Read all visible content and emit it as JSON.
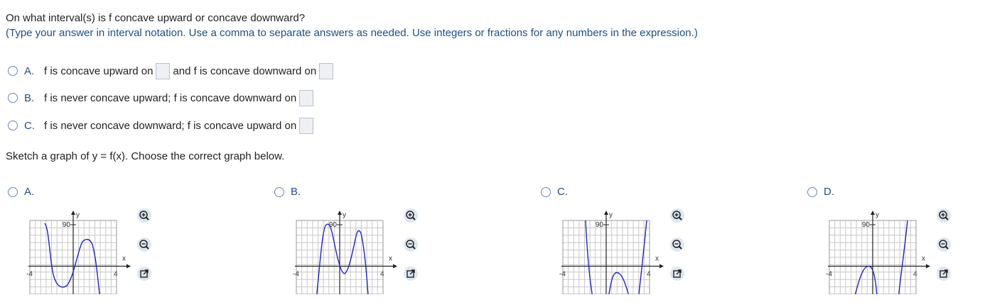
{
  "question1": {
    "prompt": "On what interval(s) is f concave upward or concave downward?",
    "instructions": "(Type your answer in interval notation. Use a comma to separate answers as needed. Use integers or fractions for any numbers in the expression.)",
    "options": [
      {
        "letter": "A.",
        "text_before": "f is concave upward on",
        "text_middle": "and f is concave downward on"
      },
      {
        "letter": "B.",
        "text_before": "f is never concave upward; f is concave downward on"
      },
      {
        "letter": "C.",
        "text_before": "f is never concave downward; f is concave upward on"
      }
    ]
  },
  "question2": {
    "prompt": "Sketch a graph of y = f(x). Choose the correct graph below.",
    "options": [
      {
        "letter": "A.",
        "ymax_label": "90",
        "xmin_label": "-4",
        "xmax_label": "4",
        "x_axis_label": "x",
        "y_axis_label": "y"
      },
      {
        "letter": "B.",
        "ymax_label": "90",
        "xmin_label": "-4",
        "xmax_label": "4",
        "x_axis_label": "x",
        "y_axis_label": "y"
      },
      {
        "letter": "C.",
        "ymax_label": "90",
        "xmin_label": "-4",
        "xmax_label": "4",
        "x_axis_label": "x",
        "y_axis_label": "y"
      },
      {
        "letter": "D.",
        "ymax_label": "90",
        "xmin_label": "-4",
        "xmax_label": "4",
        "x_axis_label": "x",
        "y_axis_label": "y"
      }
    ]
  },
  "tools": {
    "zoom_in_icon": "zoom-in-icon",
    "zoom_out_icon": "zoom-out-icon",
    "popout_icon": "popout-icon"
  },
  "colors": {
    "accent": "#1a4f8b",
    "curve": "#2222cc",
    "grid": "#c8c8c8",
    "answer_box": "#eef0f3",
    "tool_bg": "#dde7f2"
  }
}
